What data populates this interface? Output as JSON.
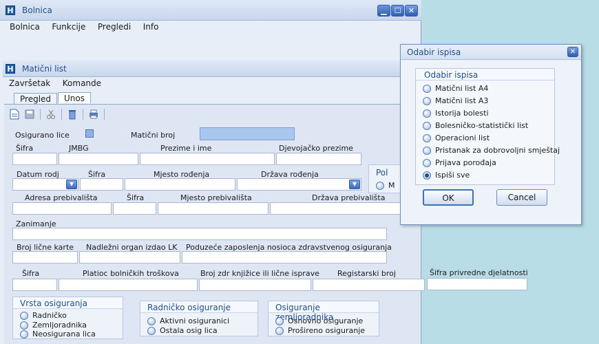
{
  "outer_window": {
    "title": "Bolnica",
    "icon_letter": "H",
    "menu": [
      "Bolnica",
      "Funkcije",
      "Pregledi",
      "Info"
    ],
    "buttons": {
      "minimize": "▁",
      "maximize": "☐",
      "close": "✕"
    }
  },
  "child_window": {
    "title": "Matični list",
    "icon_letter": "H",
    "menu": [
      "Završetak",
      "Komande"
    ],
    "tabs": [
      "Pregled",
      "Unos"
    ]
  },
  "form": {
    "osigurano_lice": "Osigurano lice",
    "maticni_broj": "Matični broj",
    "row1": [
      "Šifra",
      "JMBG",
      "Prezime i ime",
      "Djevojačko prezime"
    ],
    "row2": [
      "Datum rodj",
      "Šifra",
      "Mjesto rođenja",
      "Država rođenja"
    ],
    "pol": {
      "label": "Pol",
      "option": "M"
    },
    "row3": [
      "Adresa prebivališta",
      "Šifra",
      "Mjesto prebivališta",
      "Država prebivališta"
    ],
    "zanimanje": "Zanimanje",
    "row5": [
      "Broj lične karte",
      "Nadležni organ izdao LK",
      "Poduzeće zaposlenja nosioca zdravstvenog osiguranja"
    ],
    "row6": [
      "Šifra",
      "Platioc bolničkih troškova",
      "Broj zdr knjižice ili lične isprave",
      "Registarski broj",
      "Šifra privredne djelatnosti"
    ]
  },
  "groups": {
    "vrsta": {
      "title": "Vrsta osiguranja",
      "options": [
        "Radničko",
        "Zemljoradnika",
        "Neosigurana lica"
      ]
    },
    "radnicko": {
      "title": "Radničko osiguranje",
      "options": [
        "Aktivni osiguranici",
        "Ostala osig lica"
      ]
    },
    "zemljo": {
      "title": "Osiguranje zemljoradnika",
      "options": [
        "Osnovno osiguranje",
        "Prošireno osiguranje"
      ]
    }
  },
  "dialog": {
    "title": "Odabir ispisa",
    "close": "✕",
    "group_title": "Odabir ispisa",
    "options": [
      "Matični list A4",
      "Matični list A3",
      "Istorija bolesti",
      "Bolesničko-statistički list",
      "Operacioni list",
      "Pristanak za dobrovoljni smještaj",
      "Prijava porođaja",
      "Ispiši sve"
    ],
    "selected_index": 7,
    "ok": "OK",
    "cancel": "Cancel"
  }
}
